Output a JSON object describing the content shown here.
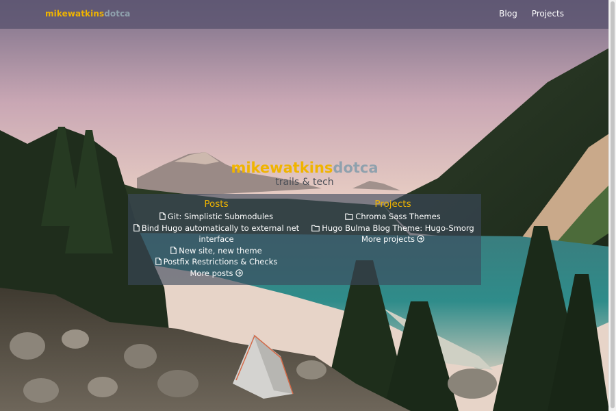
{
  "navbar": {
    "brand_part1": "mikewatkins",
    "brand_part2": "dotca",
    "links": [
      {
        "label": "Blog"
      },
      {
        "label": "Projects"
      }
    ]
  },
  "hero": {
    "title_part1": "mikewatkins",
    "title_part2": "dotca",
    "subtitle": "trails & tech"
  },
  "posts": {
    "heading": "Posts",
    "items": [
      {
        "title": "Git: Simplistic Submodules",
        "icon": "file-icon"
      },
      {
        "title": "Bind Hugo automatically to external net interface",
        "icon": "file-icon"
      },
      {
        "title": "New site, new theme",
        "icon": "file-icon"
      },
      {
        "title": "Postfix Restrictions & Checks",
        "icon": "file-icon"
      }
    ],
    "more_label": "More posts",
    "more_icon": "arrow-circle-right-icon"
  },
  "projects": {
    "heading": "Projects",
    "items": [
      {
        "title": "Chroma Sass Themes",
        "icon": "folder-icon"
      },
      {
        "title": "Hugo Bulma Blog Theme: Hugo-Smorg",
        "icon": "folder-icon"
      }
    ],
    "more_label": "More projects",
    "more_icon": "arrow-circle-right-icon"
  },
  "colors": {
    "accent": "#f0b400",
    "brand_secondary": "#8fa1ad",
    "navbar_bg": "#58526e",
    "panel_bg": "#3c485c"
  }
}
